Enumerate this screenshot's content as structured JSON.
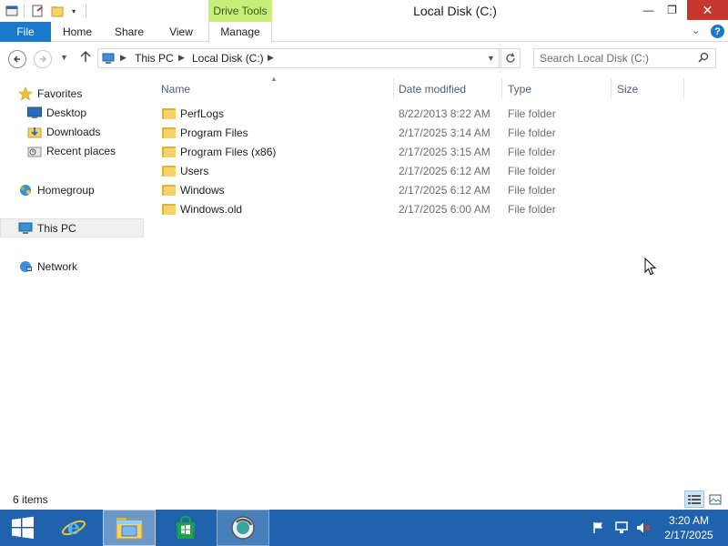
{
  "window": {
    "title": "Local Disk (C:)",
    "contextual_tab_group": "Drive Tools",
    "close_glyph": "✕",
    "minimize_glyph": "—",
    "restore_glyph": "❐"
  },
  "ribbon": {
    "tabs": [
      "File",
      "Home",
      "Share",
      "View",
      "Manage"
    ],
    "help_glyph": "?",
    "file_tab_color": "#1979ca",
    "drive_tools_color": "#c6ef7a"
  },
  "address": {
    "crumbs": [
      "This PC",
      "Local Disk (C:)"
    ],
    "search_placeholder": "Search Local Disk (C:)"
  },
  "nav_pane": {
    "favorites": "Favorites",
    "favorites_items": [
      "Desktop",
      "Downloads",
      "Recent places"
    ],
    "homegroup": "Homegroup",
    "this_pc": "This PC",
    "network": "Network"
  },
  "file_list": {
    "columns": [
      "Name",
      "Date modified",
      "Type",
      "Size"
    ],
    "rows": [
      {
        "name": "PerfLogs",
        "date": "8/22/2013 8:22 AM",
        "type": "File folder"
      },
      {
        "name": "Program Files",
        "date": "2/17/2025 3:14 AM",
        "type": "File folder"
      },
      {
        "name": "Program Files (x86)",
        "date": "2/17/2025 3:15 AM",
        "type": "File folder"
      },
      {
        "name": "Users",
        "date": "2/17/2025 6:12 AM",
        "type": "File folder"
      },
      {
        "name": "Windows",
        "date": "2/17/2025 6:12 AM",
        "type": "File folder"
      },
      {
        "name": "Windows.old",
        "date": "2/17/2025 6:00 AM",
        "type": "File folder"
      }
    ]
  },
  "status": {
    "item_count": "6 items"
  },
  "taskbar": {
    "color": "#1f63ad",
    "apps": [
      "start-icon",
      "internet-explorer-icon",
      "file-explorer-icon",
      "store-icon",
      "app-icon"
    ],
    "time": "3:20 AM",
    "date": "2/17/2025"
  }
}
